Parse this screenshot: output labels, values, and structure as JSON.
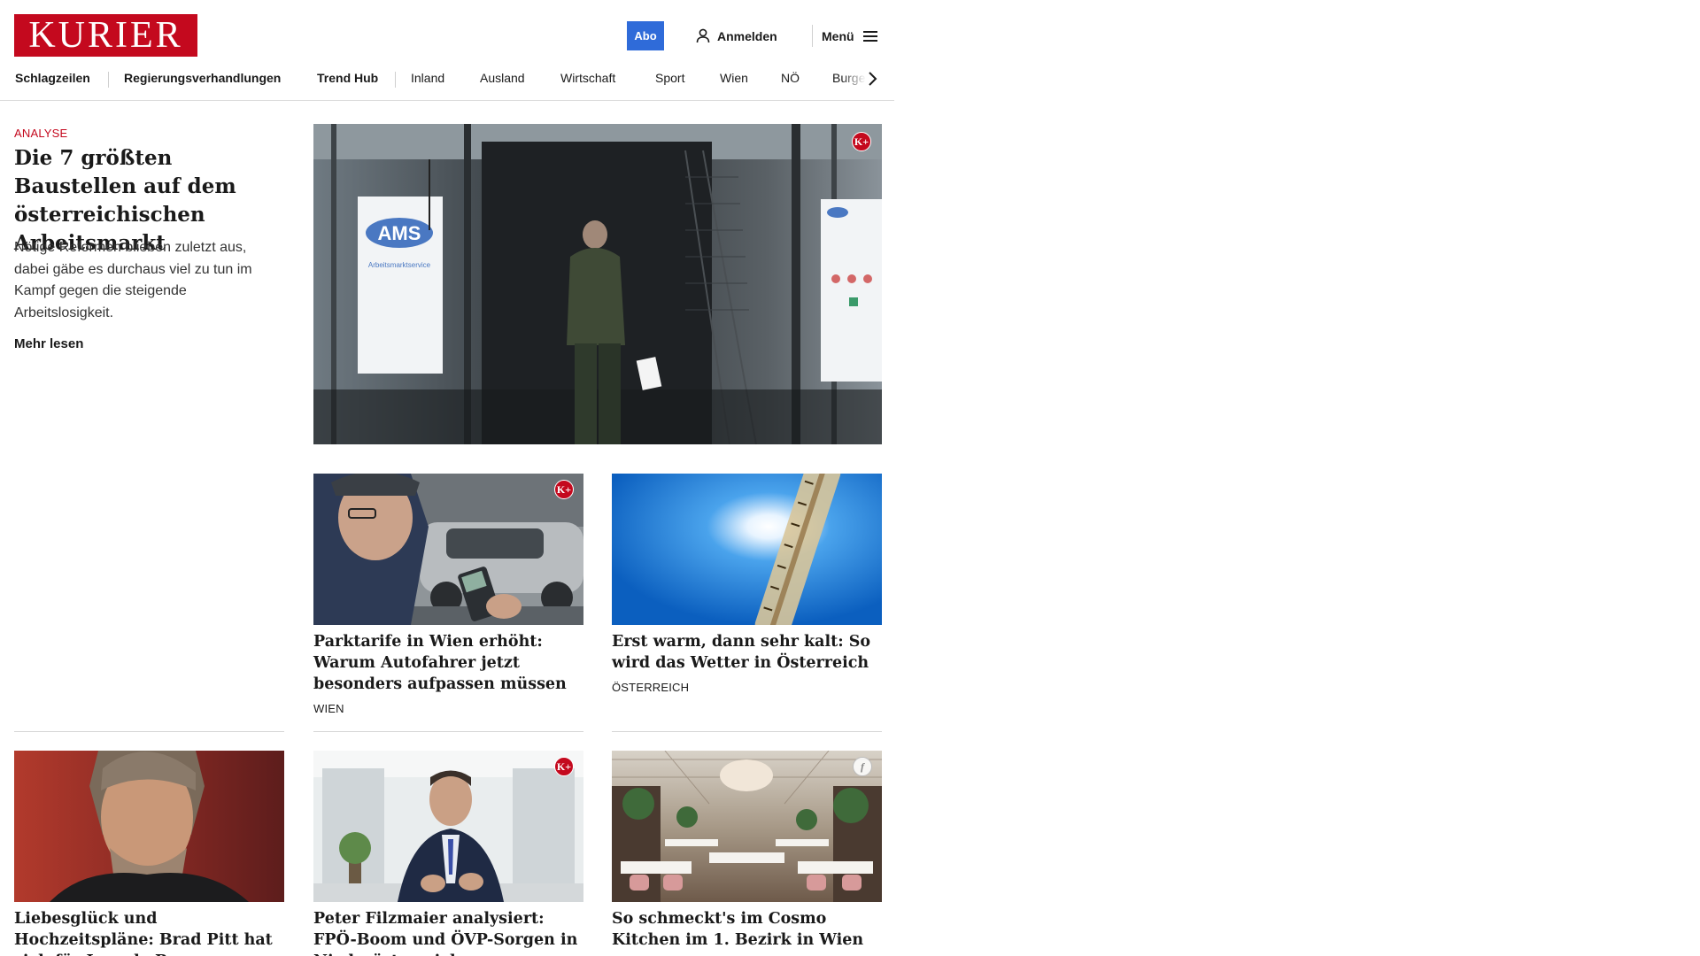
{
  "header": {
    "logo_text": "KURIER",
    "abo_label": "Abo",
    "login_label": "Anmelden",
    "menu_label": "Menü"
  },
  "nav": {
    "items": [
      {
        "label": "Schlagzeilen"
      },
      {
        "label": "Regierungsverhandlungen"
      },
      {
        "label": "Trend Hub"
      },
      {
        "label": "Inland"
      },
      {
        "label": "Ausland"
      },
      {
        "label": "Wirtschaft"
      },
      {
        "label": "Sport"
      },
      {
        "label": "Wien"
      },
      {
        "label": "NÖ"
      },
      {
        "label": "Burge"
      }
    ],
    "scroll_icon": "chevron-right-icon"
  },
  "lead": {
    "kicker": "ANALYSE",
    "title": "Die 7 größten Baustellen auf dem österreichischen Arbeitsmarkt",
    "teaser": "Nötige Reformen blieben zuletzt aus, dabei gäbe es durchaus viel zu tun im Kampf gegen die steigende Arbeitslosigkeit.",
    "more_label": "Mehr lesen",
    "image_sign_text": "AMS",
    "image_sign_subtext": "Arbeitsmarktservice",
    "premium_badge": "K+"
  },
  "cards": [
    {
      "title": "Parktarife in Wien erhöht: Warum Autofahrer jetzt besonders aufpas­sen müssen",
      "category": "WIEN",
      "premium_badge": "K+"
    },
    {
      "title": "Erst warm, dann sehr kalt: So wird das Wetter in Österreich",
      "category": "ÖSTERREICH"
    },
    {
      "title": "Liebesglück und Hochzeitspläne: Brad Pitt hat sich für Ines de Ra­mon entschieden"
    },
    {
      "title": "Peter Filzmaier analysiert: FPÖ-Boom und ÖVP-Sorgen in Niederösterreich",
      "premium_badge": "K+"
    },
    {
      "title": "So schmeckt's im Cosmo Kitchen im 1. Bezirk in Wien",
      "badge": "f"
    }
  ],
  "colors": {
    "brand_red": "#c4091e",
    "abo_blue": "#2f6bd9"
  }
}
